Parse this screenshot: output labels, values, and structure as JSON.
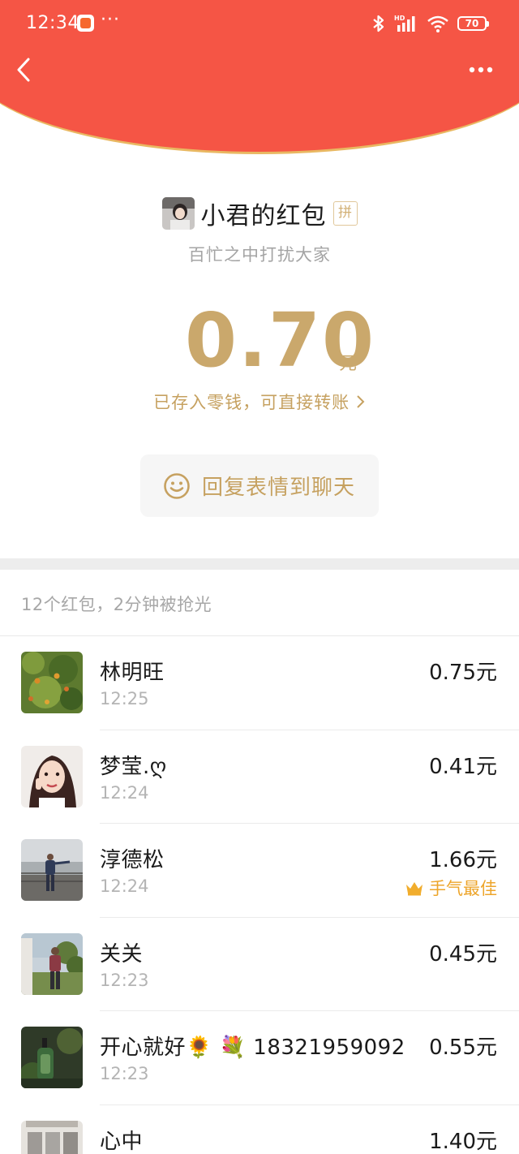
{
  "status_bar": {
    "time": "12:34",
    "dots": "···",
    "battery": "70",
    "hd_label": "HD"
  },
  "colors": {
    "header_red": "#f55545",
    "gold_text": "#caa86c",
    "best_orange": "#eda52b"
  },
  "sender": {
    "name": "小君的红包",
    "badge": "拼",
    "greeting": "百忙之中打扰大家"
  },
  "received": {
    "amount": "0.70",
    "unit": "元",
    "stored_note": "已存入零钱，可直接转账"
  },
  "reply_button": {
    "label": "回复表情到聊天",
    "icon": "smiley-icon"
  },
  "summary": "12个红包，2分钟被抢光",
  "records": [
    {
      "name": "林明旺",
      "time": "12:25",
      "amount": "0.75元",
      "best": ""
    },
    {
      "name": "梦莹.ღ",
      "time": "12:24",
      "amount": "0.41元",
      "best": ""
    },
    {
      "name": "淳德松",
      "time": "12:24",
      "amount": "1.66元",
      "best": "手气最佳"
    },
    {
      "name": "关关",
      "time": "12:23",
      "amount": "0.45元",
      "best": ""
    },
    {
      "name": "开心就好🌻 💐 18321959092",
      "time": "12:23",
      "amount": "0.55元",
      "best": ""
    },
    {
      "name": "心中",
      "time": "",
      "amount": "1.40元",
      "best": ""
    }
  ]
}
